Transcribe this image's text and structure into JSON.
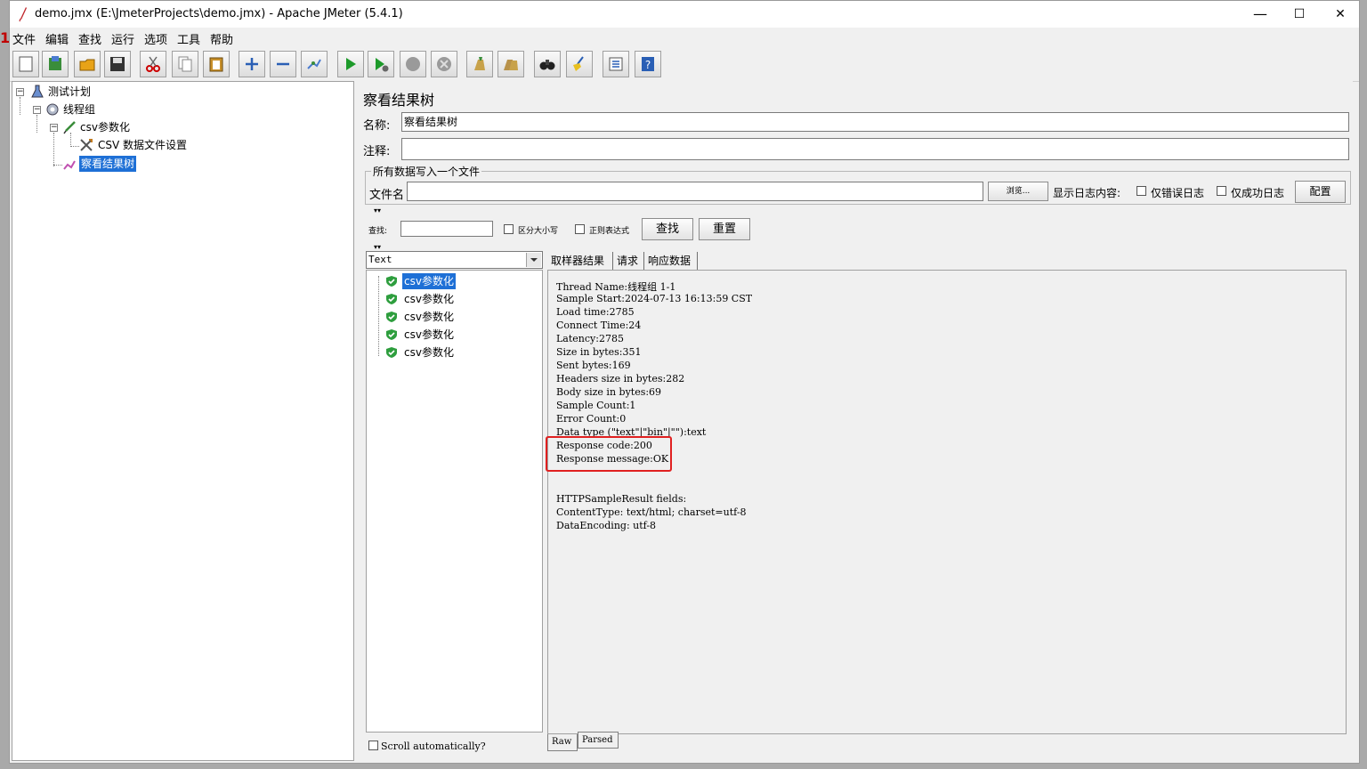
{
  "window": {
    "title": "demo.jmx (E:\\JmeterProjects\\demo.jmx) - Apache JMeter (5.4.1)",
    "minimize": "—",
    "maximize": "☐",
    "close": "✕"
  },
  "menu": [
    "文件",
    "编辑",
    "查找",
    "运行",
    "选项",
    "工具",
    "帮助"
  ],
  "toolbar": {
    "icons": [
      "new-icon",
      "templates-icon",
      "open-icon",
      "save-icon",
      "cut-icon",
      "copy-icon",
      "paste-icon",
      "expand-icon",
      "collapse-icon",
      "toggle-icon",
      "start-icon",
      "start-no-pause-icon",
      "stop-icon",
      "shutdown-icon",
      "clear-icon",
      "clear-all-icon",
      "search-icon",
      "reset-search-icon",
      "function-helper-icon",
      "help-icon"
    ]
  },
  "tree": {
    "test_plan": "测试计划",
    "thread_group": "线程组",
    "csv_param": "csv参数化",
    "csv_config": "CSV 数据文件设置",
    "view_results": "察看结果树"
  },
  "panel": {
    "heading": "察看结果树",
    "name_label": "名称:",
    "name_value": "察看结果树",
    "comment_label": "注释:",
    "comment_value": "",
    "group_title": "所有数据写入一个文件",
    "filename_label": "文件名",
    "filename_value": "",
    "browse_button": "浏览...",
    "log_label": "显示日志内容:",
    "errors_only": "仅错误日志",
    "success_only": "仅成功日志",
    "config_button": "配置"
  },
  "search": {
    "label": "查找:",
    "value": "",
    "case_sensitive": "区分大小写",
    "regex": "正则表达式",
    "find_button": "查找",
    "reset_button": "重置"
  },
  "results": {
    "renderer": "Text",
    "items": [
      "csv参数化",
      "csv参数化",
      "csv参数化",
      "csv参数化",
      "csv参数化"
    ],
    "scroll_auto": "Scroll automatically?"
  },
  "detail_tabs": [
    "取样器结果",
    "请求",
    "响应数据"
  ],
  "detail_lines": [
    "Thread Name:线程组 1-1",
    "Sample Start:2024-07-13 16:13:59 CST",
    "Load time:2785",
    "Connect Time:24",
    "Latency:2785",
    "Size in bytes:351",
    "Sent bytes:169",
    "Headers size in bytes:282",
    "Body size in bytes:69",
    "Sample Count:1",
    "Error Count:0",
    "Data type (\"text\"|\"bin\"|\"\"):text",
    "Response code:200",
    "Response message:OK",
    "",
    "",
    "HTTPSampleResult fields:",
    "ContentType: text/html; charset=utf-8",
    "DataEncoding: utf-8"
  ],
  "bottom_tabs": [
    "Raw",
    "Parsed"
  ],
  "colors": {
    "selection": "#1e70d6",
    "highlight_box": "#e02020",
    "success_icon": "#2e9e3e"
  }
}
